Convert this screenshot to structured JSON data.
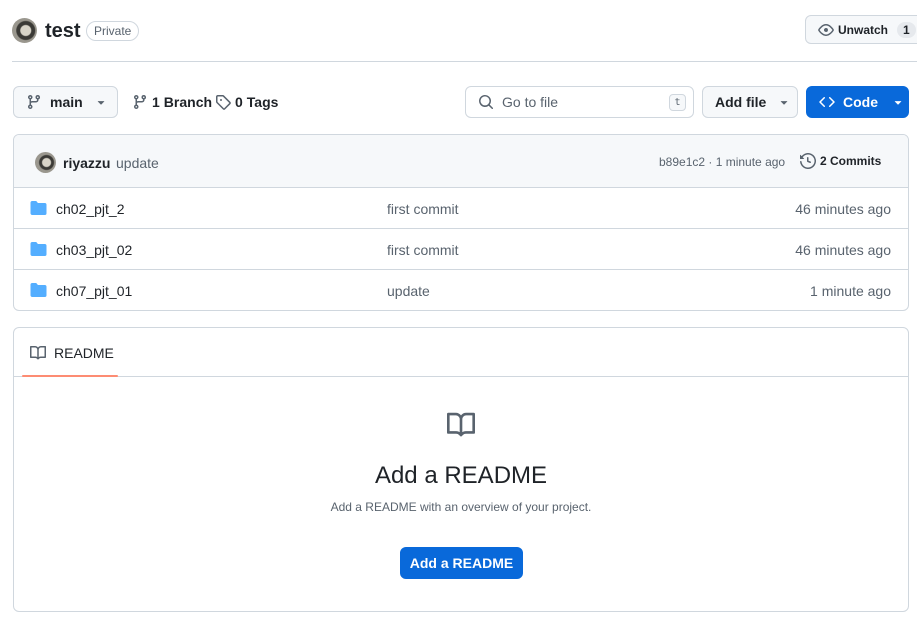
{
  "repo": {
    "name": "test",
    "visibility": "Private"
  },
  "watch": {
    "label": "Unwatch",
    "count": "1"
  },
  "toolbar": {
    "branch": "main",
    "branches_count": "1",
    "branches_label": "Branch",
    "tags_count": "0",
    "tags_label": "Tags",
    "goto_placeholder": "Go to file",
    "goto_shortcut": "t",
    "add_file_label": "Add file",
    "code_label": "Code"
  },
  "latest_commit": {
    "author": "riyazzu",
    "message": "update",
    "hash_time": "b89e1c2 · 1 minute ago",
    "commits_label": "2 Commits"
  },
  "files": [
    {
      "name": "ch02_pjt_2",
      "commit": "first commit",
      "time": "46 minutes ago"
    },
    {
      "name": "ch03_pjt_02",
      "commit": "first commit",
      "time": "46 minutes ago"
    },
    {
      "name": "ch07_pjt_01",
      "commit": "update",
      "time": "1 minute ago"
    }
  ],
  "readme": {
    "tab_label": "README",
    "title": "Add a README",
    "subtitle": "Add a README with an overview of your project.",
    "button_label": "Add a README"
  },
  "colors": {
    "accent": "#0969da",
    "folder": "#54aeff",
    "tab_underline": "#fd8c73",
    "border": "#d0d7de"
  },
  "icons": {
    "branch": "git-branch-icon",
    "tag": "tag-icon",
    "search": "search-icon",
    "eye": "eye-icon",
    "code": "code-icon",
    "history": "history-icon",
    "folder": "folder-icon",
    "book": "book-icon"
  }
}
